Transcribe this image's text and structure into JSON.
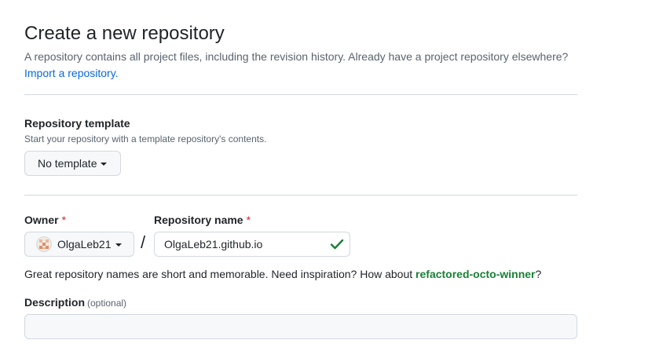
{
  "header": {
    "title": "Create a new repository",
    "subtitle": "A repository contains all project files, including the revision history. Already have a project repository elsewhere?",
    "import_link": "Import a repository."
  },
  "template": {
    "label": "Repository template",
    "help": "Start your repository with a template repository's contents.",
    "selected": "No template"
  },
  "owner": {
    "label": "Owner",
    "required_mark": "*",
    "selected": "OlgaLeb21",
    "avatar_icon": "identicon-avatar"
  },
  "separator": "/",
  "repo_name": {
    "label": "Repository name",
    "required_mark": "*",
    "value": "OlgaLeb21.github.io",
    "status_icon": "check-icon",
    "status_color": "#1a7f37"
  },
  "hint": {
    "prefix": "Great repository names are short and memorable. Need inspiration? How about ",
    "suggestion": "refactored-octo-winner",
    "suffix": "?"
  },
  "description": {
    "label": "Description",
    "optional_label": "(optional)",
    "value": ""
  },
  "colors": {
    "link": "#0969da",
    "required": "#d1242f",
    "suggestion": "#1a7f37",
    "border": "#d1d9e0"
  }
}
